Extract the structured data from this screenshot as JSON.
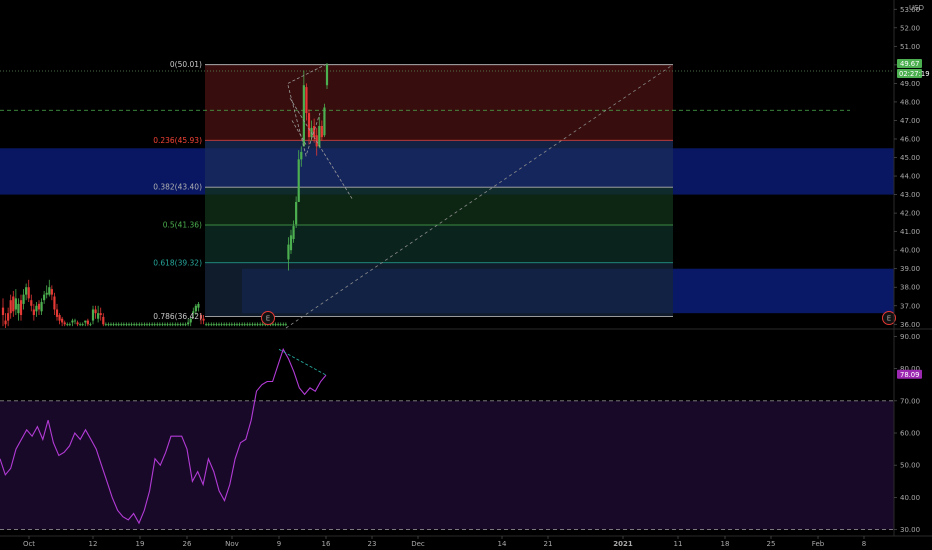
{
  "chart_data": [
    {
      "type": "candlestick",
      "currency": "USD",
      "last_price": "49.67",
      "countdown": "02:27:19",
      "y_ticks": [
        "36.00",
        "37.00",
        "38.00",
        "39.00",
        "40.00",
        "41.00",
        "42.00",
        "43.00",
        "44.00",
        "45.00",
        "46.00",
        "47.00",
        "48.00",
        "49.00",
        "50.00",
        "51.00",
        "52.00",
        "53.00"
      ],
      "ylim": [
        35.8,
        53.5
      ],
      "x_tick_labels": [
        "Oct",
        "12",
        "19",
        "26",
        "Nov",
        "9",
        "16",
        "23",
        "Dec",
        "14",
        "21",
        "2021",
        "11",
        "18",
        "25",
        "Feb",
        "8"
      ],
      "fibonacci": [
        {
          "label": "0(50.01)",
          "value": 50.01,
          "color": "#c8c8c8"
        },
        {
          "label": "0.236(45.93)",
          "value": 45.93,
          "color": "#f44336"
        },
        {
          "label": "0.382(43.40)",
          "value": 43.4,
          "color": "#b0b0b0"
        },
        {
          "label": "0.5(41.36)",
          "value": 41.36,
          "color": "#4caf50"
        },
        {
          "label": "0.618(39.32)",
          "value": 39.32,
          "color": "#26a69a"
        },
        {
          "label": "0.786(36.42)",
          "value": 36.42,
          "color": "#c8c8c8"
        }
      ],
      "candles": [
        [
          36.9,
          36.5,
          37.4,
          35.9
        ],
        [
          36.2,
          36.0,
          36.6,
          35.8
        ],
        [
          36.6,
          36.2,
          36.9,
          35.9
        ],
        [
          37.3,
          36.6,
          37.6,
          36.3
        ],
        [
          37.5,
          36.7,
          37.8,
          36.4
        ],
        [
          36.8,
          37.4,
          37.9,
          36.5
        ],
        [
          36.6,
          37.1,
          37.4,
          36.2
        ],
        [
          37.3,
          36.5,
          37.6,
          36.2
        ],
        [
          37.1,
          37.6,
          37.9,
          36.8
        ],
        [
          37.6,
          38.0,
          38.2,
          37.3
        ],
        [
          38.0,
          37.4,
          38.4,
          37.2
        ],
        [
          37.3,
          37.0,
          37.6,
          36.7
        ],
        [
          36.8,
          36.5,
          37.1,
          36.2
        ],
        [
          36.7,
          37.0,
          37.2,
          36.4
        ],
        [
          37.1,
          36.8,
          37.3,
          36.5
        ],
        [
          36.7,
          37.2,
          37.4,
          36.5
        ],
        [
          37.3,
          37.6,
          37.8,
          37.1
        ],
        [
          37.6,
          37.7,
          38.1,
          37.4
        ],
        [
          37.6,
          38.0,
          38.4,
          37.5
        ],
        [
          37.9,
          37.6,
          38.1,
          37.3
        ],
        [
          37.5,
          36.8,
          37.7,
          36.5
        ],
        [
          36.8,
          36.4,
          37.1,
          36.2
        ],
        [
          36.5,
          36.2,
          36.6,
          36.0
        ],
        [
          36.3,
          36.1,
          36.4,
          35.9
        ],
        [
          36.1,
          36.0,
          36.2,
          35.9
        ],
        [
          36.0,
          36.0,
          36.1,
          35.9
        ],
        [
          36.0,
          36.0,
          36.1,
          35.9
        ],
        [
          36.1,
          36.2,
          36.3,
          35.9
        ],
        [
          36.2,
          36.2,
          36.3,
          36.0
        ],
        [
          36.1,
          36.0,
          36.2,
          35.9
        ],
        [
          36.0,
          36.0,
          36.1,
          35.9
        ],
        [
          36.0,
          36.0,
          36.1,
          35.9
        ],
        [
          36.1,
          36.2,
          36.2,
          35.9
        ],
        [
          36.2,
          36.0,
          36.3,
          35.9
        ],
        [
          36.0,
          36.0,
          36.1,
          35.9
        ],
        [
          36.2,
          36.8,
          37.0,
          36.0
        ],
        [
          36.8,
          36.6,
          37.0,
          36.3
        ],
        [
          36.3,
          36.6,
          37.0,
          36.1
        ],
        [
          36.6,
          36.5,
          36.9,
          36.2
        ],
        [
          36.4,
          36.0,
          36.6,
          35.9
        ],
        [
          36.0,
          36.0,
          36.1,
          35.9
        ],
        [
          36.0,
          36.0,
          36.1,
          35.9
        ],
        [
          36.0,
          36.0,
          36.1,
          35.9
        ],
        [
          36.0,
          36.0,
          36.1,
          35.9
        ],
        [
          36.0,
          36.0,
          36.1,
          35.9
        ],
        [
          36.0,
          36.0,
          36.1,
          35.9
        ],
        [
          36.0,
          36.0,
          36.1,
          35.9
        ],
        [
          36.0,
          36.0,
          36.1,
          35.9
        ],
        [
          36.0,
          36.0,
          36.1,
          35.9
        ],
        [
          36.0,
          36.0,
          36.1,
          35.9
        ],
        [
          36.0,
          36.0,
          36.1,
          35.9
        ],
        [
          36.0,
          36.0,
          36.1,
          35.9
        ],
        [
          36.0,
          36.0,
          36.1,
          35.9
        ],
        [
          36.0,
          36.0,
          36.1,
          35.9
        ],
        [
          36.0,
          36.0,
          36.1,
          35.9
        ],
        [
          36.0,
          36.0,
          36.1,
          35.9
        ],
        [
          36.0,
          36.0,
          36.1,
          35.9
        ],
        [
          36.0,
          36.0,
          36.1,
          35.9
        ],
        [
          36.0,
          36.0,
          36.1,
          35.9
        ],
        [
          36.0,
          36.0,
          36.1,
          35.9
        ],
        [
          36.0,
          36.0,
          36.1,
          35.9
        ],
        [
          36.0,
          36.0,
          36.1,
          35.9
        ],
        [
          36.0,
          36.0,
          36.1,
          35.9
        ],
        [
          36.0,
          36.0,
          36.1,
          35.9
        ],
        [
          36.0,
          36.0,
          36.1,
          35.9
        ],
        [
          36.0,
          36.0,
          36.1,
          35.9
        ],
        [
          36.0,
          36.0,
          36.1,
          35.9
        ],
        [
          36.0,
          36.0,
          36.1,
          35.9
        ],
        [
          36.0,
          36.0,
          36.1,
          35.9
        ],
        [
          36.0,
          36.0,
          36.1,
          35.9
        ],
        [
          36.0,
          36.0,
          36.1,
          35.9
        ],
        [
          36.0,
          36.0,
          36.1,
          35.9
        ],
        [
          36.0,
          36.1,
          36.3,
          35.9
        ],
        [
          36.1,
          36.3,
          36.4,
          35.9
        ],
        [
          36.6,
          36.7,
          36.9,
          36.3
        ],
        [
          36.7,
          37.0,
          37.1,
          36.5
        ],
        [
          36.9,
          37.1,
          37.2,
          36.7
        ],
        [
          36.5,
          36.3,
          36.6,
          36.0
        ],
        [
          36.3,
          36.2,
          36.5,
          36.0
        ],
        [
          36.0,
          36.0,
          36.1,
          35.9
        ],
        [
          36.0,
          36.0,
          36.1,
          35.9
        ],
        [
          36.0,
          36.0,
          36.1,
          35.9
        ],
        [
          36.0,
          36.0,
          36.1,
          35.9
        ],
        [
          36.0,
          36.0,
          36.1,
          35.9
        ],
        [
          36.0,
          36.0,
          36.1,
          35.9
        ],
        [
          36.0,
          36.0,
          36.1,
          35.9
        ],
        [
          36.0,
          36.0,
          36.1,
          35.9
        ],
        [
          36.0,
          36.0,
          36.1,
          35.9
        ],
        [
          36.0,
          36.0,
          36.1,
          35.9
        ],
        [
          36.0,
          36.0,
          36.1,
          35.9
        ],
        [
          36.0,
          36.0,
          36.1,
          35.9
        ],
        [
          36.0,
          36.0,
          36.1,
          35.9
        ],
        [
          36.0,
          36.0,
          36.1,
          35.9
        ],
        [
          36.0,
          36.0,
          36.1,
          35.9
        ],
        [
          36.0,
          36.0,
          36.1,
          35.9
        ],
        [
          36.0,
          36.0,
          36.1,
          35.9
        ],
        [
          36.0,
          36.0,
          36.1,
          35.9
        ],
        [
          36.0,
          36.0,
          36.1,
          35.9
        ],
        [
          36.0,
          36.0,
          36.1,
          35.9
        ],
        [
          36.0,
          36.0,
          36.1,
          35.9
        ],
        [
          36.0,
          36.0,
          36.1,
          35.9
        ],
        [
          36.0,
          36.0,
          36.1,
          35.9
        ],
        [
          36.0,
          36.0,
          36.1,
          35.9
        ],
        [
          36.0,
          36.0,
          36.1,
          35.9
        ],
        [
          36.0,
          36.0,
          36.1,
          35.9
        ],
        [
          36.0,
          36.0,
          36.1,
          35.9
        ],
        [
          36.0,
          36.0,
          36.1,
          35.9
        ],
        [
          36.0,
          36.0,
          36.1,
          35.9
        ],
        [
          36.0,
          36.0,
          36.1,
          35.9
        ],
        [
          36.0,
          36.0,
          36.1,
          35.9
        ],
        [
          36.0,
          36.0,
          36.1,
          35.9
        ],
        [
          39.5,
          40.3,
          40.7,
          38.9
        ],
        [
          40.0,
          40.8,
          41.1,
          39.8
        ],
        [
          40.6,
          41.3,
          41.6,
          40.4
        ],
        [
          41.4,
          42.6,
          42.9,
          41.2
        ],
        [
          42.6,
          44.9,
          45.4,
          42.6
        ],
        [
          44.9,
          45.3,
          45.6,
          44.5
        ],
        [
          45.6,
          48.9,
          49.7,
          45.6
        ],
        [
          48.8,
          47.4,
          49.0,
          47.0
        ],
        [
          47.4,
          46.1,
          47.6,
          45.7
        ],
        [
          46.1,
          46.6,
          47.0,
          45.9
        ],
        [
          46.7,
          46.1,
          47.1,
          45.8
        ],
        [
          46.2,
          45.6,
          46.6,
          45.1
        ],
        [
          45.6,
          46.7,
          47.2,
          45.5
        ],
        [
          46.7,
          46.1,
          47.0,
          45.9
        ],
        [
          46.2,
          47.7,
          47.9,
          46.1
        ],
        [
          48.9,
          50.0,
          50.1,
          48.7
        ]
      ]
    },
    {
      "type": "line",
      "y_ticks": [
        "30.00",
        "40.00",
        "50.00",
        "60.00",
        "70.00",
        "80.00",
        "90.00"
      ],
      "ylim": [
        28,
        92
      ],
      "last_value": "78.09",
      "bands": [
        30,
        70
      ],
      "values": [
        52,
        47,
        49,
        55,
        58,
        61,
        59,
        62,
        58,
        64,
        57,
        53,
        54,
        56,
        60,
        58,
        61,
        58,
        55,
        50,
        45,
        40,
        36,
        34,
        33,
        35,
        32,
        36,
        42,
        52,
        50,
        54,
        59,
        59,
        59,
        55,
        45,
        48,
        44,
        52,
        48,
        42,
        39,
        44,
        52,
        57,
        58,
        64,
        73,
        75,
        76,
        76,
        81,
        86,
        83,
        79,
        74,
        72,
        74,
        73,
        76,
        78
      ]
    }
  ]
}
